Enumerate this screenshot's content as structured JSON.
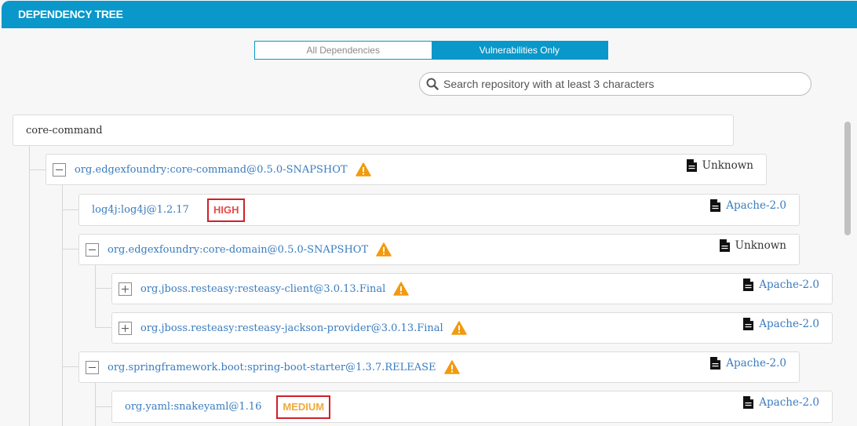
{
  "header": {
    "title": "DEPENDENCY TREE"
  },
  "toggle": {
    "all_label": "All Dependencies",
    "vuln_label": "Vulnerabilities Only",
    "active": "vulnerabilities"
  },
  "search": {
    "placeholder": "Search repository with at least 3 characters",
    "value": ""
  },
  "colors": {
    "accent": "#0a97c9",
    "link": "#3a7cbf",
    "warning": "#f29a0f",
    "high": "#e34a4a",
    "medium": "#f0a93a"
  },
  "tree": {
    "root": {
      "name": "core-command"
    },
    "nodes": [
      {
        "name": "org.edgexfoundry:core-command@0.5.0-SNAPSHOT",
        "expander": "minus",
        "warning": true,
        "license": "Unknown"
      },
      {
        "name": "log4j:log4j@1.2.17",
        "severity": "HIGH",
        "license": "Apache-2.0"
      },
      {
        "name": "org.edgexfoundry:core-domain@0.5.0-SNAPSHOT",
        "expander": "minus",
        "warning": true,
        "license": "Unknown"
      },
      {
        "name": "org.jboss.resteasy:resteasy-client@3.0.13.Final",
        "expander": "plus",
        "warning": true,
        "license": "Apache-2.0"
      },
      {
        "name": "org.jboss.resteasy:resteasy-jackson-provider@3.0.13.Final",
        "expander": "plus",
        "warning": true,
        "license": "Apache-2.0"
      },
      {
        "name": "org.springframework.boot:spring-boot-starter@1.3.7.RELEASE",
        "expander": "minus",
        "warning": true,
        "license": "Apache-2.0"
      },
      {
        "name": "org.yaml:snakeyaml@1.16",
        "severity": "MEDIUM",
        "license": "Apache-2.0"
      }
    ]
  }
}
